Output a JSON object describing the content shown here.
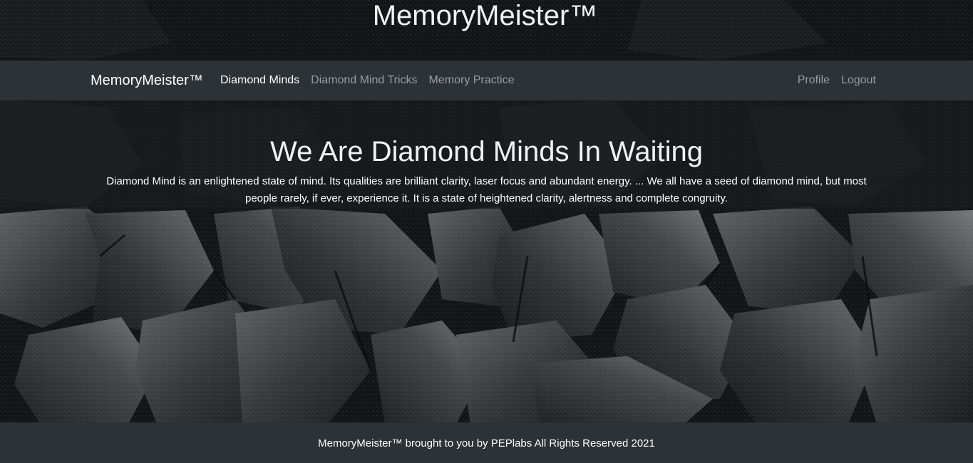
{
  "site": {
    "title": "MemoryMeister™"
  },
  "navbar": {
    "brand": "MemoryMeister™",
    "links": [
      {
        "label": "Diamond Minds",
        "active": true
      },
      {
        "label": "Diamond Mind Tricks",
        "active": false
      },
      {
        "label": "Memory Practice",
        "active": false
      }
    ],
    "right_links": [
      {
        "label": "Profile"
      },
      {
        "label": "Logout"
      }
    ]
  },
  "hero": {
    "heading": "We Are Diamond Minds In Waiting",
    "text": "Diamond Mind is an enlightened state of mind. Its qualities are brilliant clarity, laser focus and abundant energy. ... We all have a seed of diamond mind, but most people rarely, if ever, experience it. It is a state of heightened clarity, alertness and complete congruity."
  },
  "footer": {
    "text": "MemoryMeister™ brought to you by PEPlabs All Rights Reserved 2021"
  },
  "colors": {
    "background": "#16181b",
    "navbar": "#2d3236",
    "footer": "#2d3236",
    "active_link": "#ffffff",
    "inactive_link": "#9a9c9e"
  }
}
